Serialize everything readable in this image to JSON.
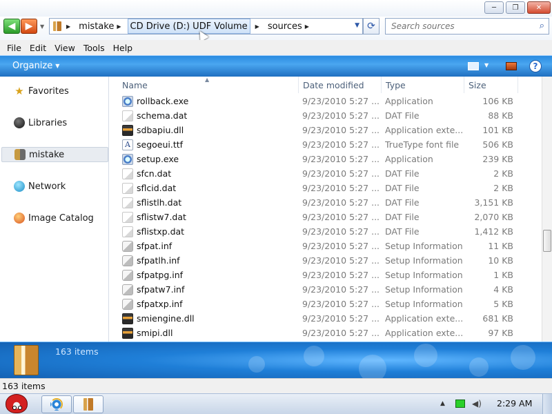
{
  "window": {
    "minimize_label": "─",
    "maximize_label": "❐",
    "close_label": "✕"
  },
  "address": {
    "crumbs": [
      "mistake",
      "CD Drive (D:) UDF Volume",
      "sources"
    ],
    "search_placeholder": "Search sources"
  },
  "menu": [
    "File",
    "Edit",
    "View",
    "Tools",
    "Help"
  ],
  "toolbar": {
    "organize_label": "Organize",
    "help_label": "?"
  },
  "nav": {
    "items": [
      "Favorites",
      "Libraries",
      "mistake",
      "Network",
      "Image Catalog"
    ],
    "selected": "mistake"
  },
  "columns": {
    "name": "Name",
    "date": "Date modified",
    "type": "Type",
    "size": "Size"
  },
  "files": [
    {
      "name": "rollback.exe",
      "date": "9/23/2010 5:27 ...",
      "type": "Application",
      "size": "106 KB",
      "icon": "exe-icon"
    },
    {
      "name": "schema.dat",
      "date": "9/23/2010 5:27 ...",
      "type": "DAT File",
      "size": "88 KB",
      "icon": "dat-icon"
    },
    {
      "name": "sdbapiu.dll",
      "date": "9/23/2010 5:27 ...",
      "type": "Application exte...",
      "size": "101 KB",
      "icon": "dll-icon"
    },
    {
      "name": "segoeui.ttf",
      "date": "9/23/2010 5:27 ...",
      "type": "TrueType font file",
      "size": "506 KB",
      "icon": "ttf-icon"
    },
    {
      "name": "setup.exe",
      "date": "9/23/2010 5:27 ...",
      "type": "Application",
      "size": "239 KB",
      "icon": "exe-icon"
    },
    {
      "name": "sfcn.dat",
      "date": "9/23/2010 5:27 ...",
      "type": "DAT File",
      "size": "2 KB",
      "icon": "dat-icon"
    },
    {
      "name": "sflcid.dat",
      "date": "9/23/2010 5:27 ...",
      "type": "DAT File",
      "size": "2 KB",
      "icon": "dat-icon"
    },
    {
      "name": "sflistlh.dat",
      "date": "9/23/2010 5:27 ...",
      "type": "DAT File",
      "size": "3,151 KB",
      "icon": "dat-icon"
    },
    {
      "name": "sflistw7.dat",
      "date": "9/23/2010 5:27 ...",
      "type": "DAT File",
      "size": "2,070 KB",
      "icon": "dat-icon"
    },
    {
      "name": "sflistxp.dat",
      "date": "9/23/2010 5:27 ...",
      "type": "DAT File",
      "size": "1,412 KB",
      "icon": "dat-icon"
    },
    {
      "name": "sfpat.inf",
      "date": "9/23/2010 5:27 ...",
      "type": "Setup Information",
      "size": "11 KB",
      "icon": "inf-icon"
    },
    {
      "name": "sfpatlh.inf",
      "date": "9/23/2010 5:27 ...",
      "type": "Setup Information",
      "size": "10 KB",
      "icon": "inf-icon"
    },
    {
      "name": "sfpatpg.inf",
      "date": "9/23/2010 5:27 ...",
      "type": "Setup Information",
      "size": "1 KB",
      "icon": "inf-icon"
    },
    {
      "name": "sfpatw7.inf",
      "date": "9/23/2010 5:27 ...",
      "type": "Setup Information",
      "size": "4 KB",
      "icon": "inf-icon"
    },
    {
      "name": "sfpatxp.inf",
      "date": "9/23/2010 5:27 ...",
      "type": "Setup Information",
      "size": "5 KB",
      "icon": "inf-icon"
    },
    {
      "name": "smiengine.dll",
      "date": "9/23/2010 5:27 ...",
      "type": "Application exte...",
      "size": "681 KB",
      "icon": "dll-icon"
    },
    {
      "name": "smipi.dll",
      "date": "9/23/2010 5:27 ...",
      "type": "Application exte...",
      "size": "97 KB",
      "icon": "dll-icon"
    }
  ],
  "details": {
    "count": "163 items"
  },
  "status": {
    "count": "163 items"
  },
  "taskbar": {
    "clock": "2:29 AM"
  }
}
